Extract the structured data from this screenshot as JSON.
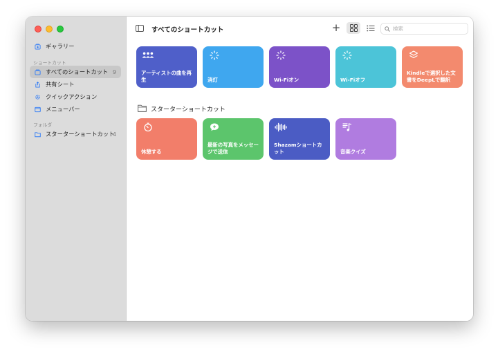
{
  "window": {
    "title": "すべてのショートカット"
  },
  "sidebar": {
    "gallery_label": "ギャラリー",
    "section_shortcuts": "ショートカット",
    "items": [
      {
        "label": "すべてのショートカット",
        "count": "9",
        "selected": true
      },
      {
        "label": "共有シート"
      },
      {
        "label": "クイックアクション"
      },
      {
        "label": "メニューバー"
      }
    ],
    "section_folders": "フォルダ",
    "folders": [
      {
        "label": "スターターショートカット",
        "count": "4"
      }
    ]
  },
  "toolbar": {
    "add_symbol": "+",
    "search_placeholder": "検索"
  },
  "shortcuts": [
    {
      "label": "アーティストの曲を再生",
      "color": "#4f5fc9",
      "icon": "people-icon"
    },
    {
      "label": "消灯",
      "color": "#3fa7ef",
      "icon": "sparkle-icon"
    },
    {
      "label": "Wi-Fiオン",
      "color": "#7c52c8",
      "icon": "sparkle-icon"
    },
    {
      "label": "Wi-Fiオフ",
      "color": "#4cc4d8",
      "icon": "sparkle-icon"
    },
    {
      "label": "Kindleで選択した文書をDeepLで翻訳",
      "color": "#f38a6e",
      "icon": "layers-icon"
    }
  ],
  "folder_section": {
    "title": "スターターショートカット",
    "shortcuts": [
      {
        "label": "休憩する",
        "color": "#f27e6a",
        "icon": "timer-icon"
      },
      {
        "label": "最新の写真をメッセージで送信",
        "color": "#5cc56c",
        "icon": "message-icon"
      },
      {
        "label": "Shazamショートカット",
        "color": "#4b5cc4",
        "icon": "waveform-icon"
      },
      {
        "label": "音楽クイズ",
        "color": "#b07ce0",
        "icon": "music-list-icon"
      }
    ]
  }
}
